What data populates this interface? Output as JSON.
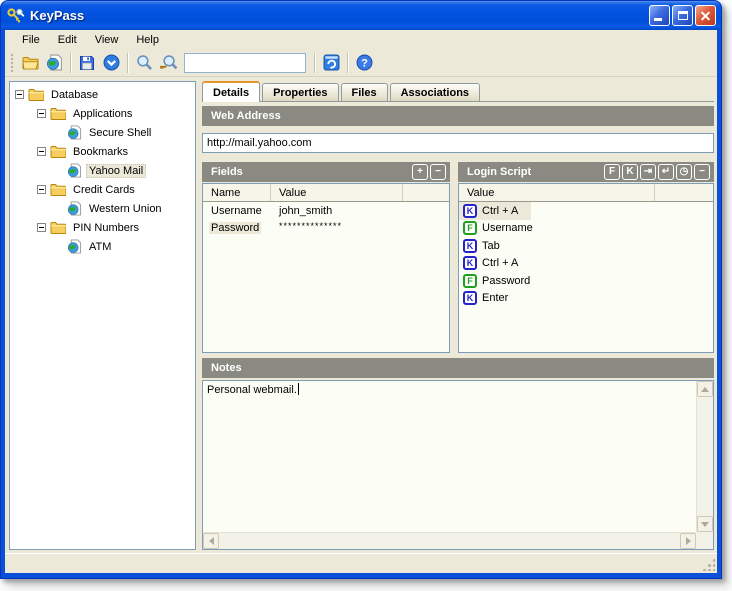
{
  "window": {
    "title": "KeyPass",
    "app_icon": "keys-icon",
    "controls": [
      {
        "name": "minimize-button"
      },
      {
        "name": "maximize-button"
      },
      {
        "name": "close-button"
      }
    ]
  },
  "menu": {
    "items": [
      {
        "label": "File"
      },
      {
        "label": "Edit"
      },
      {
        "label": "View"
      },
      {
        "label": "Help"
      }
    ]
  },
  "toolbar": {
    "search_value": "",
    "icons": [
      "open-database-icon",
      "new-web-entry-icon",
      "save-icon",
      "commit-icon",
      "search-icon",
      "find-entry-icon",
      "auto-type-icon",
      "help-icon"
    ]
  },
  "tree": {
    "items": [
      {
        "label": "Database",
        "level": 0,
        "type": "folder",
        "selected": false
      },
      {
        "label": "Applications",
        "level": 1,
        "type": "folder",
        "selected": false
      },
      {
        "label": "Secure Shell",
        "level": 2,
        "type": "entry",
        "selected": false
      },
      {
        "label": "Bookmarks",
        "level": 1,
        "type": "folder",
        "selected": false
      },
      {
        "label": "Yahoo Mail",
        "level": 2,
        "type": "entry",
        "selected": true
      },
      {
        "label": "Credit Cards",
        "level": 1,
        "type": "folder",
        "selected": false
      },
      {
        "label": "Western Union",
        "level": 2,
        "type": "entry",
        "selected": false
      },
      {
        "label": "PIN Numbers",
        "level": 1,
        "type": "folder",
        "selected": false
      },
      {
        "label": "ATM",
        "level": 2,
        "type": "entry",
        "selected": false
      }
    ]
  },
  "tabs": [
    {
      "label": "Details",
      "active": true
    },
    {
      "label": "Properties",
      "active": false
    },
    {
      "label": "Files",
      "active": false
    },
    {
      "label": "Associations",
      "active": false
    }
  ],
  "details": {
    "web_address": {
      "header": "Web Address",
      "value": "http://mail.yahoo.com"
    },
    "fields": {
      "header": "Fields",
      "buttons": [
        {
          "name": "add-field-button",
          "glyph": "+"
        },
        {
          "name": "remove-field-button",
          "glyph": "−"
        }
      ],
      "columns": {
        "name": "Name",
        "value": "Value"
      },
      "rows": [
        {
          "name": "Username",
          "value": "john_smith",
          "selected": false
        },
        {
          "name": "Password",
          "value": "**************",
          "selected": true
        }
      ]
    },
    "login_script": {
      "header": "Login Script",
      "buttons": [
        {
          "name": "insert-field-button",
          "glyph": "F"
        },
        {
          "name": "insert-key-button",
          "glyph": "K"
        },
        {
          "name": "insert-tab-button",
          "glyph": "⇥"
        },
        {
          "name": "insert-enter-button",
          "glyph": "↵"
        },
        {
          "name": "insert-delay-button",
          "glyph": "◷"
        },
        {
          "name": "remove-step-button",
          "glyph": "−"
        }
      ],
      "column": "Value",
      "items": [
        {
          "type": "K",
          "label": "Ctrl + A",
          "selected": true
        },
        {
          "type": "F",
          "label": "Username",
          "selected": false
        },
        {
          "type": "K",
          "label": "Tab",
          "selected": false
        },
        {
          "type": "K",
          "label": "Ctrl + A",
          "selected": false
        },
        {
          "type": "F",
          "label": "Password",
          "selected": false
        },
        {
          "type": "K",
          "label": "Enter",
          "selected": false
        }
      ]
    },
    "notes": {
      "header": "Notes",
      "value": "Personal webmail."
    }
  },
  "colors": {
    "titlebar_blue": "#0353E0",
    "window_bg": "#ECE9D8",
    "section_header_gray": "#8A8A82",
    "panel_border": "#7F9DB9",
    "selection_beige": "#ECE9D8",
    "key_blue": "#2424C8",
    "field_green": "#1FA11F",
    "active_tab_orange": "#E5942C",
    "close_red": "#D44A32"
  }
}
